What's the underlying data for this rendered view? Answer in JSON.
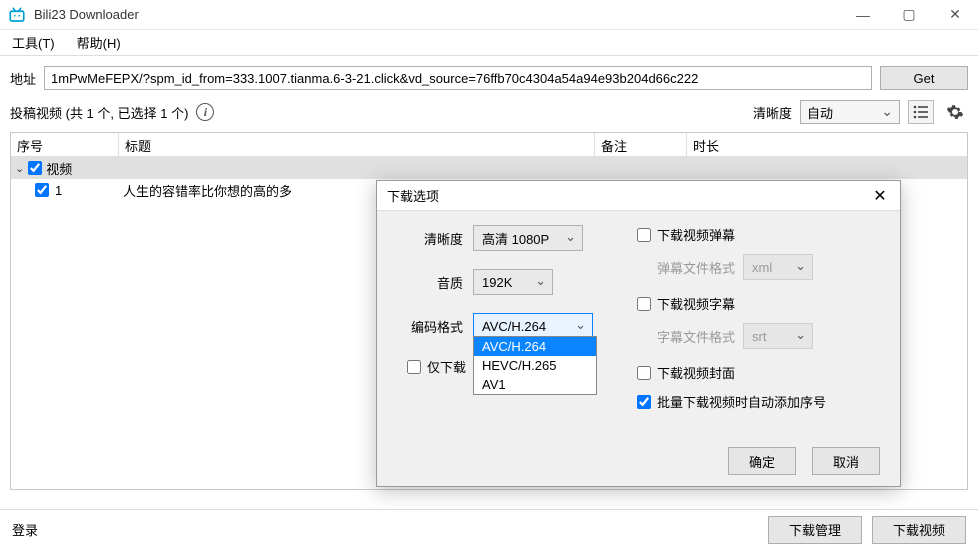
{
  "app": {
    "title": "Bili23 Downloader"
  },
  "menu": {
    "tools": "工具(T)",
    "help": "帮助(H)"
  },
  "addr": {
    "label": "地址",
    "value": "1mPwMeFEPX/?spm_id_from=333.1007.tianma.6-3-21.click&vd_source=76ffb70c4304a54a94e93b204d66c222",
    "get": "Get"
  },
  "info": {
    "summary": "投稿视频 (共 1 个, 已选择 1 个)",
    "clarity_label": "清晰度",
    "clarity_value": "自动"
  },
  "cols": {
    "seq": "序号",
    "title": "标题",
    "note": "备注",
    "dur": "时长"
  },
  "tree": {
    "group": "视频",
    "item_seq": "1",
    "item_title": "人生的容错率比你想的高的多"
  },
  "footer": {
    "login": "登录",
    "manage": "下载管理",
    "download": "下载视频"
  },
  "dialog": {
    "title": "下载选项",
    "clarity_label": "清晰度",
    "clarity_value": "高清 1080P",
    "audio_label": "音质",
    "audio_value": "192K",
    "codec_label": "编码格式",
    "codec_value": "AVC/H.264",
    "codec_options": [
      "AVC/H.264",
      "HEVC/H.265",
      "AV1"
    ],
    "only_audio": "仅下载",
    "chk_danmu": "下载视频弹幕",
    "danmu_fmt_label": "弹幕文件格式",
    "danmu_fmt_value": "xml",
    "chk_subtitle": "下载视频字幕",
    "subtitle_fmt_label": "字幕文件格式",
    "subtitle_fmt_value": "srt",
    "chk_cover": "下载视频封面",
    "chk_batch": "批量下载视频时自动添加序号",
    "ok": "确定",
    "cancel": "取消"
  }
}
